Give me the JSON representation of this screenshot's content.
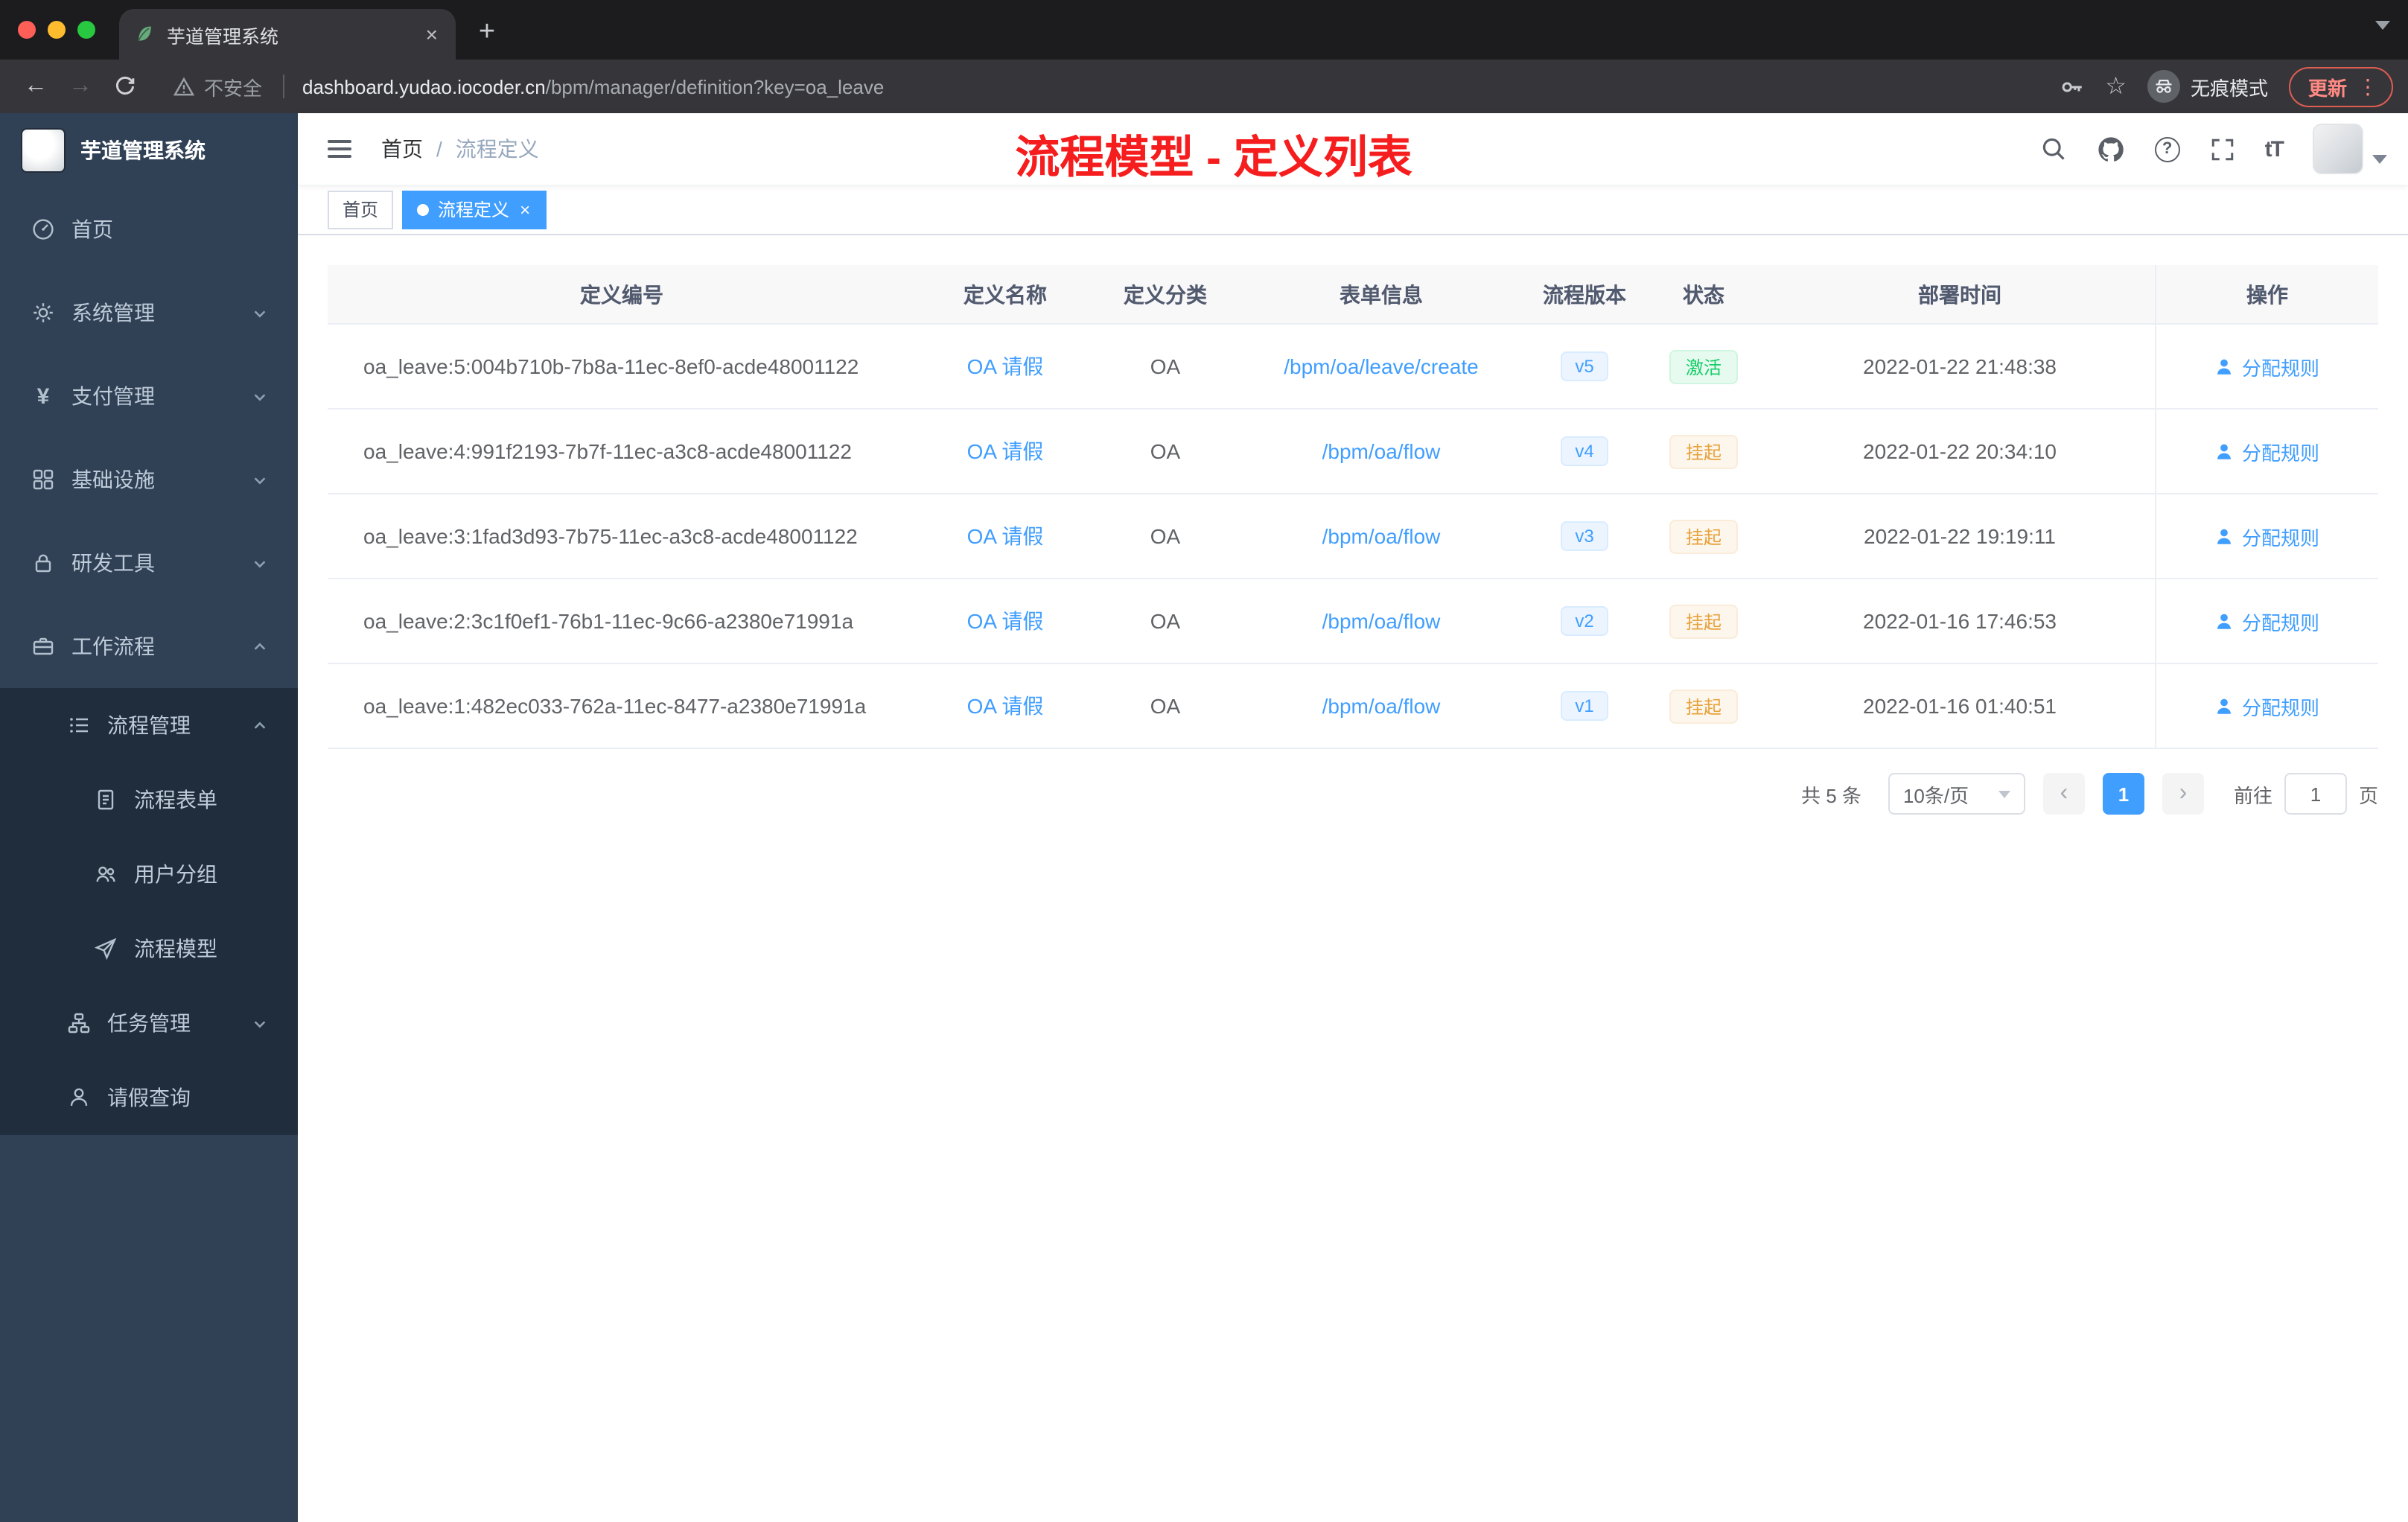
{
  "browser": {
    "tab_title": "芋道管理系统",
    "security_label": "不安全",
    "url_domain": "dashboard.yudao.iocoder.cn",
    "url_path": "/bpm/manager/definition?key=oa_leave",
    "incognito_label": "无痕模式",
    "update_label": "更新"
  },
  "icons": {
    "new_tab": "+",
    "tab_close": "×",
    "back": "←",
    "forward": "→",
    "star": "☆",
    "more": "⋮",
    "yen": "¥",
    "question": "?",
    "font_size": "tT",
    "breadcrumb_sep": "/",
    "tag_close": "×",
    "prev": "‹",
    "next": "›"
  },
  "sidebar": {
    "title": "芋道管理系统",
    "items": [
      {
        "label": "首页"
      },
      {
        "label": "系统管理"
      },
      {
        "label": "支付管理"
      },
      {
        "label": "基础设施"
      },
      {
        "label": "研发工具"
      },
      {
        "label": "工作流程",
        "expanded": true,
        "children": [
          {
            "label": "流程管理",
            "expanded": true,
            "children": [
              {
                "label": "流程表单"
              },
              {
                "label": "用户分组"
              },
              {
                "label": "流程模型"
              }
            ]
          },
          {
            "label": "任务管理"
          },
          {
            "label": "请假查询"
          }
        ]
      }
    ]
  },
  "header": {
    "breadcrumb": [
      "首页",
      "流程定义"
    ],
    "annotation": "流程模型 - 定义列表"
  },
  "tags": [
    {
      "label": "首页",
      "active": false
    },
    {
      "label": "流程定义",
      "active": true
    }
  ],
  "table": {
    "columns": [
      "定义编号",
      "定义名称",
      "定义分类",
      "表单信息",
      "流程版本",
      "状态",
      "部署时间",
      "操作"
    ],
    "rows": [
      {
        "id": "oa_leave:5:004b710b-7b8a-11ec-8ef0-acde48001122",
        "name": "OA 请假",
        "category": "OA",
        "form": "/bpm/oa/leave/create",
        "version": "v5",
        "status": "激活",
        "status_type": "active",
        "time": "2022-01-22 21:48:38",
        "action": "分配规则"
      },
      {
        "id": "oa_leave:4:991f2193-7b7f-11ec-a3c8-acde48001122",
        "name": "OA 请假",
        "category": "OA",
        "form": "/bpm/oa/flow",
        "version": "v4",
        "status": "挂起",
        "status_type": "suspended",
        "time": "2022-01-22 20:34:10",
        "action": "分配规则"
      },
      {
        "id": "oa_leave:3:1fad3d93-7b75-11ec-a3c8-acde48001122",
        "name": "OA 请假",
        "category": "OA",
        "form": "/bpm/oa/flow",
        "version": "v3",
        "status": "挂起",
        "status_type": "suspended",
        "time": "2022-01-22 19:19:11",
        "action": "分配规则"
      },
      {
        "id": "oa_leave:2:3c1f0ef1-76b1-11ec-9c66-a2380e71991a",
        "name": "OA 请假",
        "category": "OA",
        "form": "/bpm/oa/flow",
        "version": "v2",
        "status": "挂起",
        "status_type": "suspended",
        "time": "2022-01-16 17:46:53",
        "action": "分配规则"
      },
      {
        "id": "oa_leave:1:482ec033-762a-11ec-8477-a2380e71991a",
        "name": "OA 请假",
        "category": "OA",
        "form": "/bpm/oa/flow",
        "version": "v1",
        "status": "挂起",
        "status_type": "suspended",
        "time": "2022-01-16 01:40:51",
        "action": "分配规则"
      }
    ]
  },
  "pagination": {
    "total": "共 5 条",
    "page_size": "10条/页",
    "page": "1",
    "goto_label": "前往",
    "goto_value": "1",
    "goto_unit": "页"
  }
}
